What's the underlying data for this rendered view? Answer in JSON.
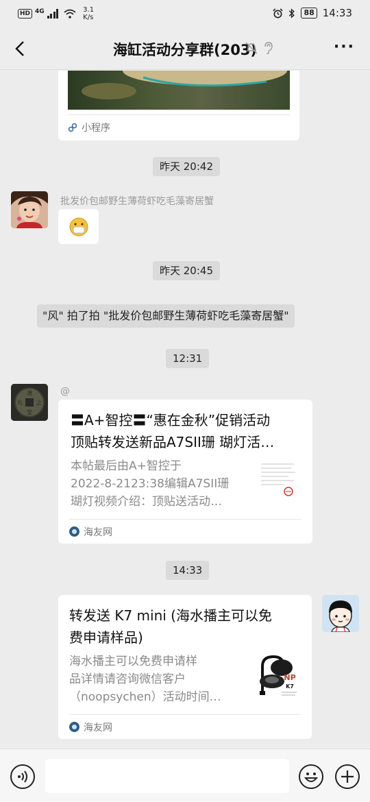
{
  "status_bar": {
    "hd": "HD",
    "net": "4G",
    "speed_value": "3.1",
    "speed_unit": "K/s",
    "battery": "88",
    "time": "14:33"
  },
  "header": {
    "title": "海缸活动分享群(203)",
    "icons": [
      "back-icon",
      "mute-bell-icon",
      "ear-icon",
      "more-icon"
    ]
  },
  "messages": {
    "top_card": {
      "source": "小程序"
    },
    "time1": "昨天 20:42",
    "msg1": {
      "nickname": "批发价包邮野生薄荷虾吃毛藻寄居蟹",
      "emoji": "😷"
    },
    "time2": "昨天 20:45",
    "pat_notice": "\"风\" 拍了拍 \"批发价包邮野生薄荷虾吃毛藻寄居蟹\"",
    "time3": "12:31",
    "msg2": {
      "nickname": "@",
      "title_line1": "〓A+智控〓“惠在金秋”促销活动",
      "title_line2": "顶贴转发送新品A7SII珊 瑚灯活…",
      "desc_line1": "本帖最后由A+智控于",
      "desc_line2": "2022-8-2123:38编辑A7SII珊",
      "desc_line3": "瑚灯视频介绍：顶贴送活动…",
      "source": "海友网"
    },
    "time4": "14:33",
    "msg3": {
      "title_line1": "转发送 K7 mini (海水播主可以免",
      "title_line2": "费申请样品)",
      "desc_line1": "海水播主可以免费申请样",
      "desc_line2": "品详情请咨询微信客户",
      "desc_line3": "（noopsychen）活动时间…",
      "source": "海友网",
      "thumb_brand": "NP",
      "thumb_model": "K7"
    }
  },
  "colors": {
    "background": "#ededed",
    "time_bg": "#dadada",
    "card_bg": "#ffffff",
    "muted_text": "#8a8a8a"
  }
}
